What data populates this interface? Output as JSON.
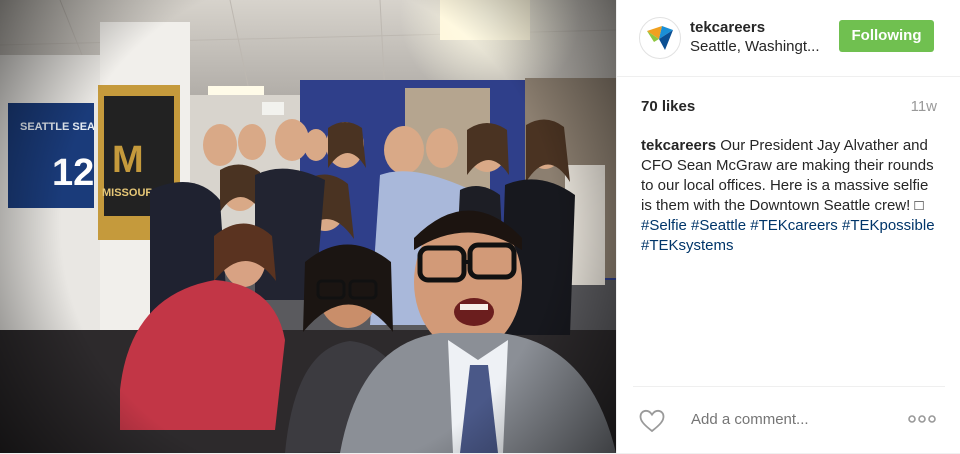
{
  "post": {
    "photo_icon": "group-selfie-photo",
    "header": {
      "avatar_icon": "tek-logo-icon",
      "username": "tekcareers",
      "location": "Seattle, Washingt...",
      "follow_label": "Following",
      "follow_color": "#70c050"
    },
    "likes": "70 likes",
    "time_ago": "11w",
    "caption": {
      "user": "tekcareers",
      "text": " Our President Jay Alvather and CFO Sean McGraw are making their rounds to our local offices. Here is a massive selfie is them with the Downtown Seattle crew! □ ",
      "hashtags": [
        "#Selfie",
        "#Seattle",
        "#TEKcareers",
        "#TEKpossible",
        "#TEKsystems"
      ],
      "hashtag_color": "#003569"
    },
    "comment": {
      "placeholder": "Add a comment...",
      "heart_icon": "heart-icon",
      "more_icon": "more-options-icon"
    }
  }
}
